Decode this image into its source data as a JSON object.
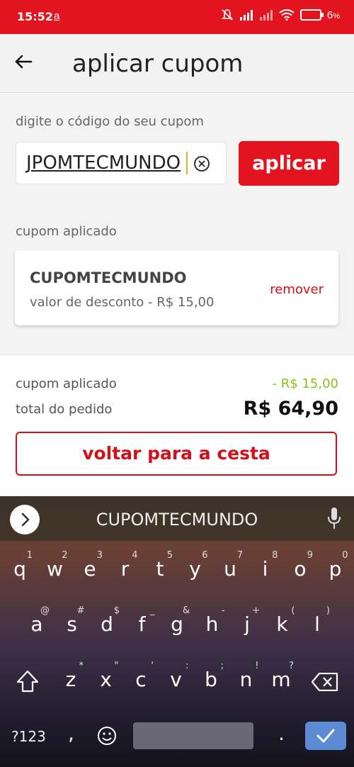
{
  "statusbar": {
    "time": "15:52",
    "notif_glyph": "a",
    "battery": "6",
    "battery_unit": "%",
    "color": "#e3141f"
  },
  "appbar": {
    "title": "aplicar cupom"
  },
  "coupon_input": {
    "label": "digite o código do seu cupom",
    "value": "JPOMTECMUNDO",
    "apply_label": "aplicar"
  },
  "applied_section": {
    "label": "cupom aplicado",
    "code": "CUPOMTECMUNDO",
    "discount_text": "valor de desconto - R$ 15,00",
    "remove_label": "remover"
  },
  "summary": {
    "coupon_label": "cupom aplicado",
    "coupon_value": "- R$ 15,00",
    "total_label": "total do pedido",
    "total_value": "R$ 64,90",
    "back_button": "voltar para a cesta"
  },
  "keyboard": {
    "suggestion": "CUPOMTECMUNDO",
    "row1": [
      [
        "q",
        "1"
      ],
      [
        "w",
        "2"
      ],
      [
        "e",
        "3"
      ],
      [
        "r",
        "4"
      ],
      [
        "t",
        "5"
      ],
      [
        "y",
        "6"
      ],
      [
        "u",
        "7"
      ],
      [
        "i",
        "8"
      ],
      [
        "o",
        "9"
      ],
      [
        "p",
        "0"
      ]
    ],
    "row2": [
      [
        "a",
        "@"
      ],
      [
        "s",
        "#"
      ],
      [
        "d",
        "$"
      ],
      [
        "f",
        "_"
      ],
      [
        "g",
        "&"
      ],
      [
        "h",
        "-"
      ],
      [
        "j",
        "+"
      ],
      [
        "k",
        "("
      ],
      [
        "l",
        ")"
      ]
    ],
    "row3": [
      [
        "z",
        "*"
      ],
      [
        "x",
        "\""
      ],
      [
        "c",
        "'"
      ],
      [
        "v",
        ":"
      ],
      [
        "b",
        ";"
      ],
      [
        "n",
        "!"
      ],
      [
        "m",
        "?"
      ]
    ],
    "symbols_key": "?123",
    "comma": ",",
    "period": "."
  },
  "colors": {
    "accent": "#e3141f",
    "discount_green": "#8cbf1a",
    "enter_blue": "#5b8cd3"
  }
}
